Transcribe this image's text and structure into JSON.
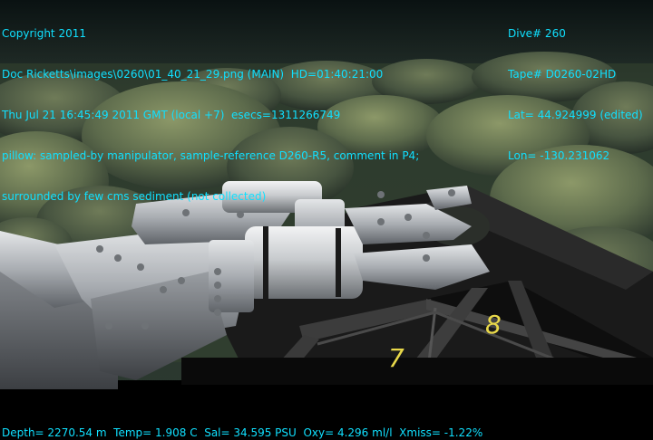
{
  "overlay": {
    "top_left": [
      "Copyright 2011",
      "Doc Ricketts\\images\\0260\\01_40_21_29.png (MAIN)  HD=01:40:21:00",
      "Thu Jul 21 16:45:49 2011 GMT (local +7)  esecs=1311266749",
      "pillow: sampled-by manipulator, sample-reference D260-R5, comment in P4;",
      "surrounded by few cms sediment (not collected)"
    ],
    "top_right": [
      "Dive# 260",
      "Tape# D0260-02HD",
      "Lat= 44.924999 (edited)",
      "Lon= -130.231062"
    ],
    "bottom": "Depth= 2270.54 m  Temp= 1.908 C  Sal= 34.595 PSU  Oxy= 4.296 ml/l  Xmiss= -1.22%"
  },
  "scene": {
    "compartment_numbers": [
      "7",
      "8"
    ],
    "colors": {
      "overlay_text": "#10e0ff",
      "seafloor": "#3a4a3c",
      "pillow_rock": "#5b6a4c",
      "sediment_highlight": "#8a9660",
      "manipulator": "#b8bcc0",
      "crate": "#141414",
      "number_label": "#e8d84a"
    }
  }
}
